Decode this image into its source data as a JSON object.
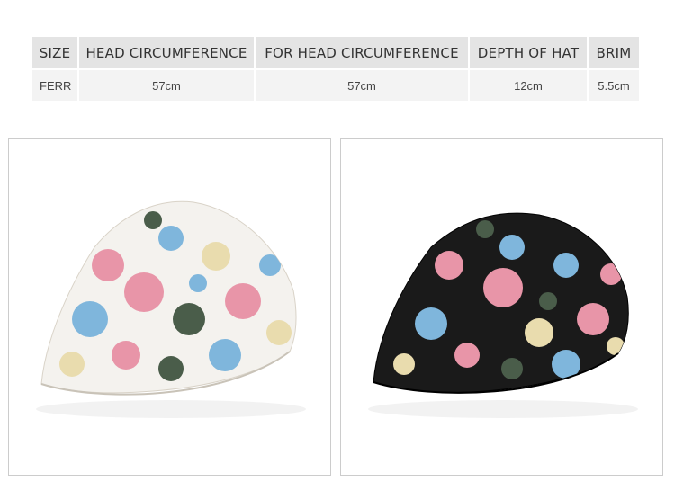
{
  "size_table": {
    "headers": [
      "SIZE",
      "HEAD CIRCUMFERENCE",
      "FOR HEAD CIRCUMFERENCE",
      "DEPTH OF HAT",
      "BRIM"
    ],
    "row": [
      "FERR",
      "57cm",
      "57cm",
      "12cm",
      "5.5cm"
    ]
  },
  "products": [
    {
      "name": "white-floral-beret-cap",
      "base_color": "#f4f2ee"
    },
    {
      "name": "black-floral-beret-cap",
      "base_color": "#1a1a1a"
    }
  ],
  "colors": {
    "header_bg": "#e4e4e4",
    "cell_bg": "#f3f3f3",
    "rose_pink": "#e895a8",
    "sky_blue": "#7fb6dc",
    "leaf_green": "#4a5d4a",
    "cream": "#e9dcae"
  }
}
